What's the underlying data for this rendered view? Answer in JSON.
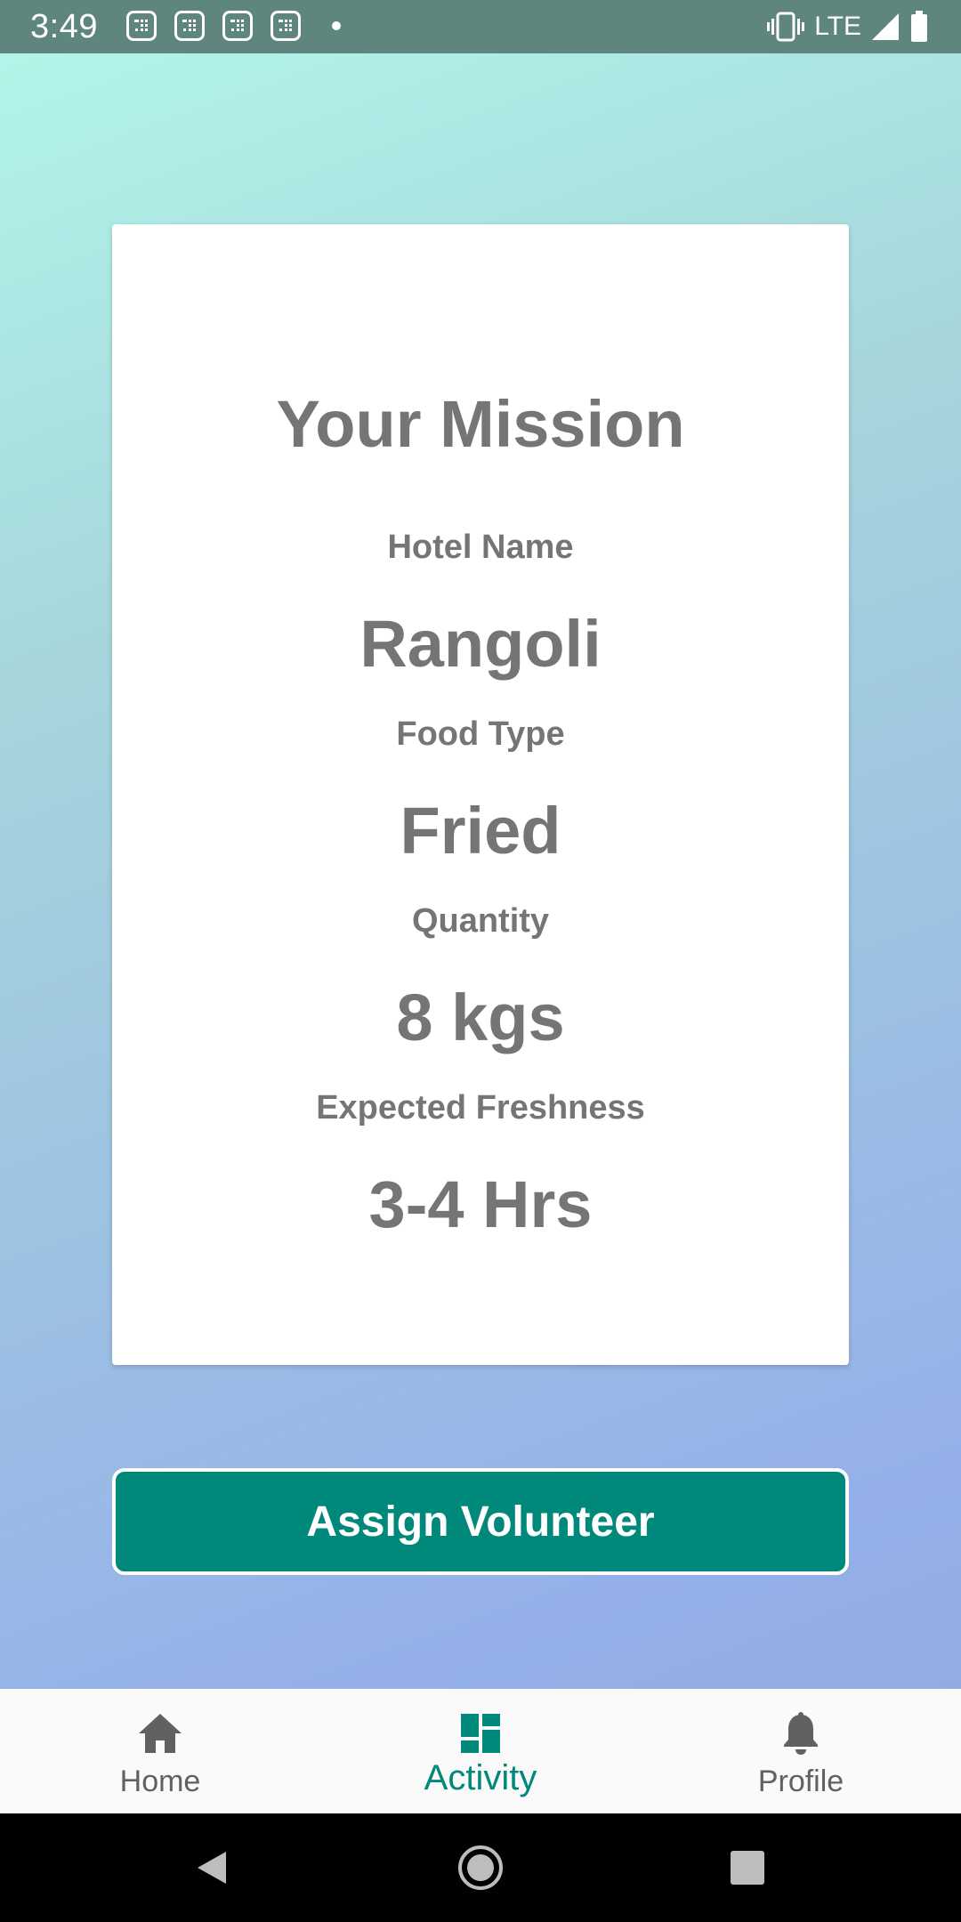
{
  "status_bar": {
    "time": "3:49",
    "network": "LTE",
    "notification_icons": [
      "notification-icon",
      "notification-icon",
      "notification-icon",
      "notification-icon"
    ]
  },
  "card": {
    "title": "Your Mission",
    "fields": [
      {
        "label": "Hotel Name",
        "value": "Rangoli"
      },
      {
        "label": "Food Type",
        "value": "Fried"
      },
      {
        "label": "Quantity",
        "value": "8 kgs"
      },
      {
        "label": "Expected Freshness",
        "value": "3-4 Hrs"
      }
    ]
  },
  "actions": {
    "assign_label": "Assign Volunteer"
  },
  "bottom_nav": {
    "items": [
      {
        "label": "Home",
        "icon": "home-icon",
        "active": false
      },
      {
        "label": "Activity",
        "icon": "dashboard-icon",
        "active": true
      },
      {
        "label": "Profile",
        "icon": "bell-icon",
        "active": false
      }
    ]
  },
  "colors": {
    "accent": "#00897b",
    "text_gray": "#757575",
    "status_bar": "#5f857f",
    "card_bg": "#ffffff"
  }
}
